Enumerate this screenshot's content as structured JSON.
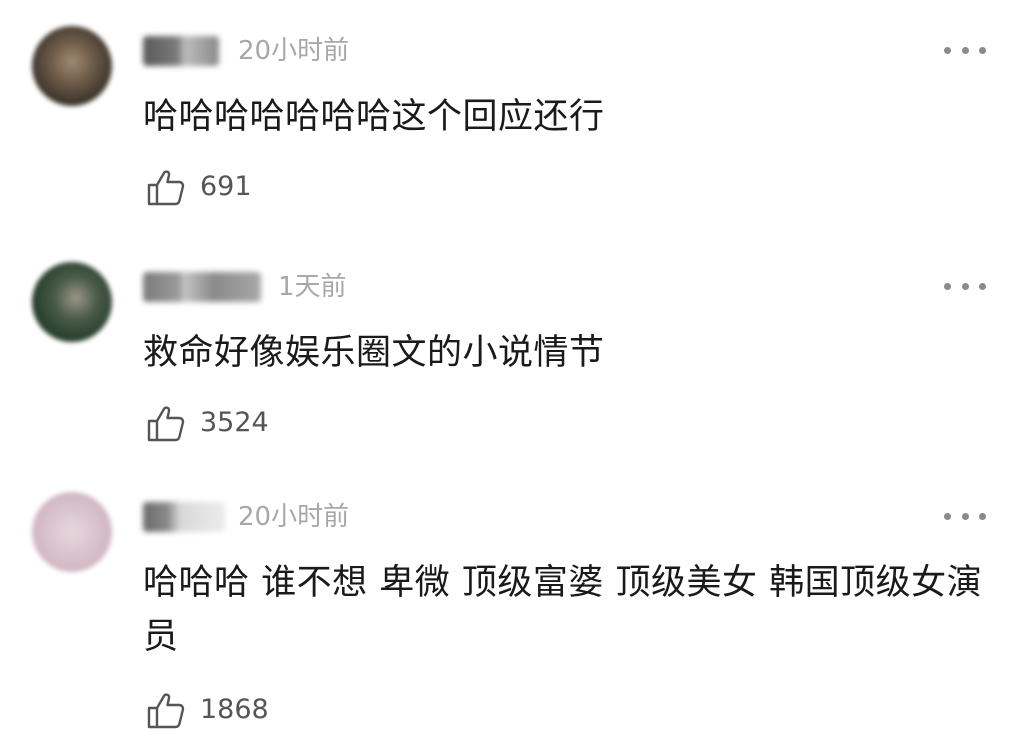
{
  "comments": [
    {
      "time": "20小时前",
      "text": "哈哈哈哈哈哈哈这个回应还行",
      "likes": "691",
      "like_icon": "thumbs-up-outline",
      "more_icon": "more-horizontal"
    },
    {
      "time": "1天前",
      "text": "救命好像娱乐圈文的小说情节",
      "likes": "3524",
      "like_icon": "thumbs-up-outline",
      "more_icon": "more-horizontal"
    },
    {
      "time": "20小时前",
      "text": "哈哈哈 谁不想 卑微 顶级富婆 顶级美女 韩国顶级女演员",
      "likes": "1868",
      "like_icon": "thumbs-up-outline",
      "more_icon": "more-horizontal"
    }
  ],
  "colors": {
    "text": "#1a1a1a",
    "meta": "#a8a8a8",
    "icon": "#555555",
    "background": "#ffffff"
  }
}
